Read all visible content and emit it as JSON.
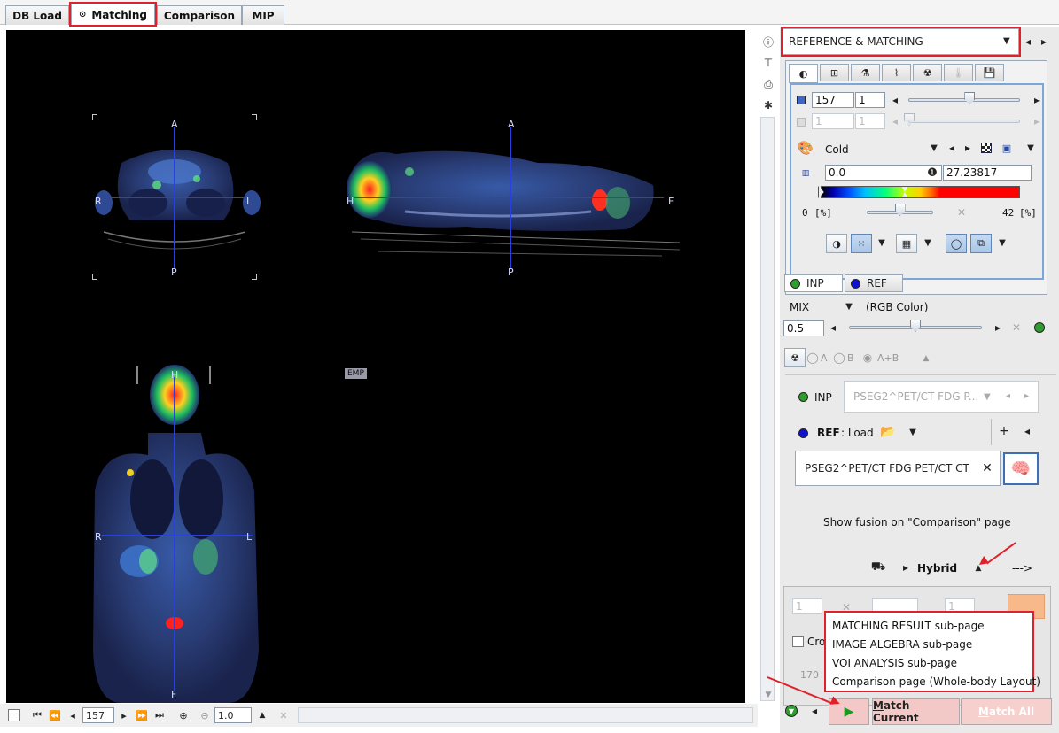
{
  "tabs": [
    {
      "label": "DB Load",
      "active": false
    },
    {
      "label": "Matching",
      "active": true
    },
    {
      "label": "Comparison",
      "active": false
    },
    {
      "label": "MIP",
      "active": false
    }
  ],
  "viewer": {
    "axial": {
      "top": "A",
      "bottom": "P",
      "left": "R",
      "right": "L"
    },
    "sagittal": {
      "top": "A",
      "bottom": "P",
      "left": "H",
      "right": "F"
    },
    "coronal": {
      "top": "H",
      "bottom": "F",
      "left": "R",
      "right": "L"
    },
    "emp_label": "EMP"
  },
  "bottom_toolbar": {
    "slice": "157",
    "zoom": "1.0"
  },
  "panel": {
    "mode": "REFERENCE & MATCHING",
    "slice_value": "157",
    "slice_step": "1",
    "slice2_value": "1",
    "slice2_step": "1",
    "colormap": "Cold",
    "min_value": "0.0",
    "max_value": "27.23817",
    "range_min_label": "0",
    "range_max_label": "42",
    "percent_label": "[%]",
    "percent_label2": "[%]",
    "slider_slice_fraction": 0.55,
    "slider_range_fraction": 0.5,
    "inp_tab": "INP",
    "ref_tab": "REF",
    "mix_label": "MIX",
    "mix_mode": "(RGB Color)",
    "mix_value": "0.5",
    "mix_fraction": 0.5,
    "radio_a": "A",
    "radio_b": "B",
    "radio_ab": "A+B",
    "inp_label": "INP",
    "inp_series": "PSEG2^PET/CT FDG P...",
    "ref_label": "REF",
    "ref_load": ": Load",
    "ref_series": "PSEG2^PET/CT FDG PET/CT CT",
    "fusion_text": "Show fusion on \"Comparison\" page",
    "hybrid_label": "Hybrid",
    "arrow_text": "--->",
    "lower_value1": "1",
    "lower_value2": "1",
    "lower_checkbox_label": "Cro",
    "lower_number": "170",
    "match_current": "Match Current",
    "match_all": "Match All"
  },
  "menu": {
    "items": [
      "MATCHING RESULT sub-page",
      "IMAGE ALGEBRA sub-page",
      "VOI ANALYSIS sub-page",
      "Comparison page (Whole-body Layout)"
    ]
  },
  "colors": {
    "highlight": "#e0202a",
    "crosshair": "#2a3fe0",
    "inp_dot": "#2e9e2e",
    "ref_dot": "#1010d0",
    "run_button_bg": "#f2c9c6"
  }
}
